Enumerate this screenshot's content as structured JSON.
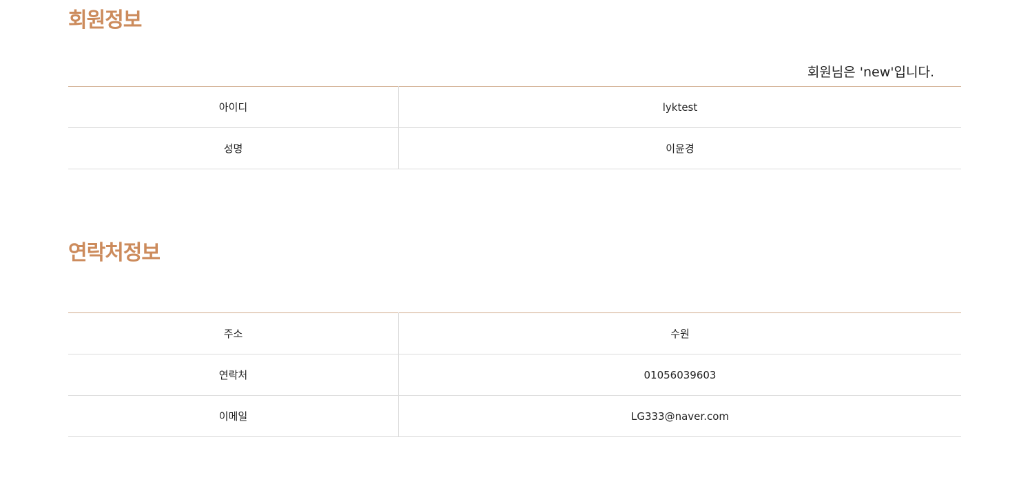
{
  "member_section": {
    "title": "회원정보",
    "grade_prefix": "회원님은 ",
    "grade": "'new'",
    "grade_suffix": "입니다.",
    "rows": [
      {
        "label": "아이디",
        "value": "lyktest"
      },
      {
        "label": "성명",
        "value": "이윤경"
      }
    ]
  },
  "contact_section": {
    "title": "연락처정보",
    "rows": [
      {
        "label": "주소",
        "value": "수원"
      },
      {
        "label": "연락처",
        "value": "01056039603"
      },
      {
        "label": "이메일",
        "value": "LG333@naver.com"
      }
    ]
  },
  "colors": {
    "title": "#cc8b5c",
    "table_top_border": "#cfa98a",
    "row_border": "#dcdcdc",
    "text": "#222222"
  }
}
